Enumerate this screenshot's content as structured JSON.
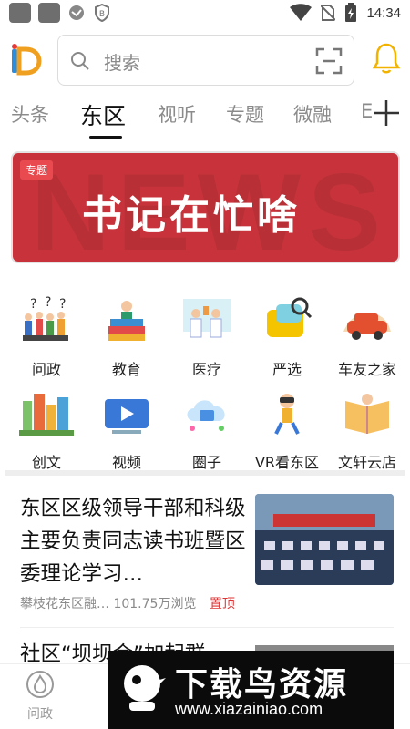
{
  "status_bar": {
    "time": "14:34"
  },
  "search": {
    "placeholder": "搜索"
  },
  "tabs": [
    {
      "label": "头条",
      "active": false
    },
    {
      "label": "东区",
      "active": true
    },
    {
      "label": "视听",
      "active": false
    },
    {
      "label": "专题",
      "active": false
    },
    {
      "label": "微融",
      "active": false
    },
    {
      "label": "E",
      "active": false
    }
  ],
  "banner": {
    "tag": "专题",
    "title": "书记在忙啥",
    "bg_text": "NEWS",
    "color": "#c8333b"
  },
  "grid": [
    {
      "label": "问政",
      "icon": "question-people-icon"
    },
    {
      "label": "教育",
      "icon": "books-icon"
    },
    {
      "label": "医疗",
      "icon": "doctors-icon"
    },
    {
      "label": "严选",
      "icon": "shopping-icon"
    },
    {
      "label": "车友之家",
      "icon": "car-icon"
    },
    {
      "label": "创文",
      "icon": "city-icon"
    },
    {
      "label": "视频",
      "icon": "video-icon"
    },
    {
      "label": "圈子",
      "icon": "cloud-icon"
    },
    {
      "label": "VR看东区",
      "icon": "vr-icon"
    },
    {
      "label": "文轩云店",
      "icon": "book-store-icon"
    }
  ],
  "articles": [
    {
      "title": "东区区级领导干部和科级主要负责同志读书班暨区委理论学习…",
      "source": "攀枝花东区融…",
      "views": "101.75万浏览",
      "pin": "置顶"
    },
    {
      "title": "社区“坝坝会”加起群"
    }
  ],
  "bottom_nav": [
    {
      "label": "问政"
    }
  ],
  "watermark": {
    "title": "下载鸟资源",
    "url": "www.xiazainiao.com"
  }
}
